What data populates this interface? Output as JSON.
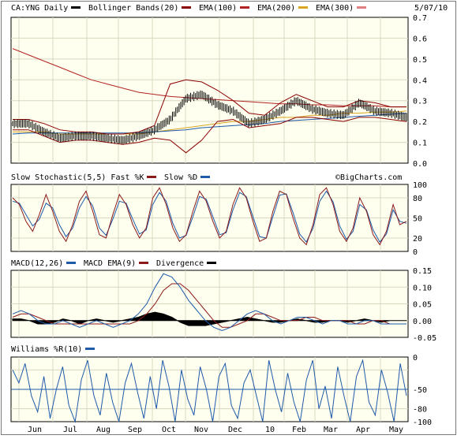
{
  "header": {
    "date": "5/07/10",
    "watermark": "©BigCharts.com"
  },
  "colors": {
    "panel_bg": "#fffff0",
    "grid": "#d8d8c0",
    "price": "#000000",
    "bollinger": "#8b0000",
    "ema100": "#b22222",
    "ema200": "#daa520",
    "ema300": "#1e5aa8",
    "ema300_swatch": "#e08080",
    "fast_k": "#8b1a1a",
    "slow_d": "#1e5aa8",
    "macd": "#1e5aa8",
    "macd_ema": "#8b1a1a",
    "divergence": "#000000",
    "williams": "#1e5aa8"
  },
  "panels": {
    "price": {
      "legend": [
        {
          "text": "CA:YNG Daily",
          "swatch": "#000000"
        },
        {
          "text": "Bollinger Bands(20)",
          "swatch": "#8b0000"
        },
        {
          "text": "EMA(100)",
          "swatch": "#b22222"
        },
        {
          "text": "EMA(200)",
          "swatch": "#daa520"
        },
        {
          "text": "EMA(300)",
          "swatch": "#e08080"
        }
      ],
      "ticks": [
        "0.7",
        "0.6",
        "0.5",
        "0.4",
        "0.3",
        "0.2",
        "0.1",
        "0.0"
      ]
    },
    "stoch": {
      "legend": [
        {
          "text": "Slow Stochastic(5,5) Fast %K",
          "swatch": "#8b1a1a"
        },
        {
          "text": "Slow %D",
          "swatch": "#1e5aa8"
        }
      ],
      "ticks": [
        "100",
        "80",
        "50",
        "20",
        "0"
      ]
    },
    "macd": {
      "legend": [
        {
          "text": "MACD(12,26)",
          "swatch": "#1e5aa8"
        },
        {
          "text": "MACD EMA(9)",
          "swatch": "#8b1a1a"
        },
        {
          "text": "Divergence",
          "swatch": "#000000"
        }
      ],
      "ticks": [
        "0.15",
        "0.10",
        "0.05",
        "0.00",
        "-0.05"
      ]
    },
    "williams": {
      "legend": [
        {
          "text": "Williams %R(10)",
          "swatch": "#1e5aa8"
        }
      ],
      "ticks": [
        "0",
        "-50",
        "-80",
        "-100"
      ]
    }
  },
  "x_axis": {
    "labels": [
      "Jun",
      "Jul",
      "Aug",
      "Sep",
      "Oct",
      "Nov",
      "Dec",
      "10",
      "Feb",
      "Mar",
      "Apr",
      "May"
    ]
  },
  "chart_data": [
    {
      "type": "line",
      "panel": "price",
      "title": "CA:YNG Daily",
      "x": [
        "2009-05-20",
        "2009-06-01",
        "2009-06-15",
        "2009-07-01",
        "2009-07-15",
        "2009-08-01",
        "2009-08-15",
        "2009-09-01",
        "2009-09-15",
        "2009-10-01",
        "2009-10-08",
        "2009-10-15",
        "2009-10-22",
        "2009-11-01",
        "2009-11-15",
        "2009-12-01",
        "2009-12-15",
        "2010-01-01",
        "2010-01-15",
        "2010-02-01",
        "2010-02-15",
        "2010-03-01",
        "2010-03-15",
        "2010-04-01",
        "2010-04-15",
        "2010-05-07"
      ],
      "series": [
        {
          "name": "CA:YNG Daily",
          "values": [
            0.19,
            0.19,
            0.15,
            0.12,
            0.13,
            0.13,
            0.12,
            0.11,
            0.13,
            0.16,
            0.21,
            0.31,
            0.33,
            0.28,
            0.25,
            0.19,
            0.21,
            0.25,
            0.3,
            0.26,
            0.24,
            0.23,
            0.29,
            0.25,
            0.24,
            0.22
          ]
        },
        {
          "name": "EMA(100)",
          "values": [
            0.55,
            0.52,
            0.49,
            0.46,
            0.43,
            0.4,
            0.38,
            0.36,
            0.34,
            0.33,
            0.32,
            0.315,
            0.31,
            0.305,
            0.3,
            0.295,
            0.29,
            0.285,
            0.285,
            0.28,
            0.28,
            0.275,
            0.275,
            0.275,
            0.27,
            0.27
          ]
        },
        {
          "name": "EMA(200)",
          "values": [
            0.15,
            0.15,
            0.15,
            0.14,
            0.14,
            0.14,
            0.14,
            0.14,
            0.14,
            0.15,
            0.16,
            0.17,
            0.18,
            0.19,
            0.2,
            0.2,
            0.21,
            0.22,
            0.22,
            0.23,
            0.23,
            0.24,
            0.24,
            0.245,
            0.245,
            0.25
          ]
        },
        {
          "name": "EMA(300)",
          "values": [
            0.14,
            0.145,
            0.145,
            0.145,
            0.145,
            0.145,
            0.145,
            0.145,
            0.145,
            0.15,
            0.155,
            0.16,
            0.17,
            0.175,
            0.18,
            0.185,
            0.19,
            0.2,
            0.205,
            0.21,
            0.215,
            0.22,
            0.225,
            0.23,
            0.235,
            0.24
          ]
        },
        {
          "name": "Bollinger Upper",
          "values": [
            0.21,
            0.21,
            0.19,
            0.16,
            0.15,
            0.15,
            0.14,
            0.14,
            0.15,
            0.18,
            0.38,
            0.4,
            0.39,
            0.35,
            0.3,
            0.24,
            0.23,
            0.29,
            0.33,
            0.3,
            0.27,
            0.27,
            0.3,
            0.29,
            0.27,
            0.27
          ]
        },
        {
          "name": "Bollinger Lower",
          "values": [
            0.16,
            0.16,
            0.13,
            0.1,
            0.11,
            0.11,
            0.1,
            0.09,
            0.1,
            0.12,
            0.11,
            0.05,
            0.11,
            0.2,
            0.21,
            0.17,
            0.18,
            0.19,
            0.22,
            0.22,
            0.21,
            0.2,
            0.22,
            0.22,
            0.21,
            0.2
          ]
        }
      ],
      "ylim": [
        0,
        0.7
      ],
      "grid": true
    },
    {
      "type": "line",
      "panel": "stoch",
      "title": "Slow Stochastic(5,5)",
      "x_count": 60,
      "series": [
        {
          "name": "Fast %K",
          "values": [
            80,
            70,
            45,
            30,
            55,
            85,
            60,
            30,
            15,
            40,
            75,
            90,
            60,
            25,
            20,
            55,
            85,
            70,
            40,
            20,
            35,
            80,
            95,
            70,
            35,
            15,
            25,
            60,
            90,
            75,
            45,
            20,
            30,
            70,
            95,
            80,
            45,
            15,
            20,
            60,
            90,
            85,
            50,
            20,
            10,
            40,
            85,
            95,
            70,
            30,
            15,
            35,
            80,
            60,
            25,
            10,
            30,
            70,
            40,
            45
          ]
        },
        {
          "name": "Slow %D",
          "values": [
            75,
            72,
            55,
            38,
            48,
            72,
            65,
            40,
            22,
            35,
            65,
            82,
            68,
            35,
            24,
            48,
            75,
            72,
            48,
            26,
            32,
            70,
            88,
            75,
            42,
            20,
            24,
            52,
            82,
            78,
            52,
            25,
            28,
            62,
            88,
            82,
            52,
            22,
            20,
            52,
            84,
            86,
            58,
            26,
            14,
            35,
            75,
            90,
            74,
            38,
            18,
            30,
            70,
            62,
            32,
            14,
            26,
            62,
            45,
            42
          ]
        }
      ],
      "ylim": [
        0,
        100
      ],
      "grid": true
    },
    {
      "type": "line",
      "panel": "macd",
      "title": "MACD(12,26)",
      "x_count": 48,
      "series": [
        {
          "name": "MACD",
          "values": [
            0.02,
            0.03,
            0.02,
            0.0,
            -0.01,
            -0.01,
            0.0,
            -0.01,
            -0.02,
            -0.01,
            0.0,
            -0.01,
            -0.02,
            -0.01,
            0.0,
            0.02,
            0.05,
            0.1,
            0.14,
            0.13,
            0.1,
            0.06,
            0.03,
            0.0,
            -0.02,
            -0.03,
            -0.02,
            0.0,
            0.02,
            0.03,
            0.02,
            0.0,
            -0.01,
            0.0,
            0.01,
            0.01,
            0.0,
            -0.01,
            0.0,
            0.0,
            -0.01,
            -0.01,
            0.0,
            0.0,
            -0.01,
            -0.01,
            -0.01,
            -0.01
          ]
        },
        {
          "name": "MACD EMA(9)",
          "values": [
            0.01,
            0.02,
            0.02,
            0.01,
            0.0,
            -0.01,
            -0.01,
            -0.01,
            -0.01,
            -0.01,
            -0.01,
            -0.01,
            -0.01,
            -0.01,
            -0.01,
            0.0,
            0.02,
            0.05,
            0.09,
            0.11,
            0.11,
            0.09,
            0.06,
            0.03,
            0.0,
            -0.02,
            -0.02,
            -0.01,
            0.0,
            0.02,
            0.02,
            0.01,
            0.0,
            0.0,
            0.0,
            0.01,
            0.01,
            0.0,
            0.0,
            0.0,
            0.0,
            -0.01,
            -0.01,
            0.0,
            0.0,
            -0.01,
            -0.01,
            -0.01
          ]
        },
        {
          "name": "Divergence",
          "values": [
            0.005,
            0.005,
            0.0,
            -0.01,
            -0.01,
            -0.005,
            0.005,
            0.0,
            -0.01,
            0.0,
            0.005,
            0.0,
            -0.005,
            0.0,
            0.005,
            0.01,
            0.02,
            0.025,
            0.02,
            0.01,
            -0.005,
            -0.015,
            -0.015,
            -0.015,
            -0.01,
            -0.005,
            0.0,
            0.005,
            0.01,
            0.005,
            0.0,
            -0.005,
            -0.005,
            0.0,
            0.005,
            0.0,
            -0.005,
            -0.005,
            0.0,
            0.0,
            -0.005,
            0.0,
            0.005,
            0.0,
            -0.005,
            0.0,
            0.0,
            0.0
          ]
        }
      ],
      "ylim": [
        -0.05,
        0.15
      ],
      "grid": true
    },
    {
      "type": "line",
      "panel": "williams",
      "title": "Williams %R(10)",
      "x_count": 64,
      "series": [
        {
          "name": "Williams %R",
          "values": [
            -20,
            -40,
            -10,
            -60,
            -85,
            -30,
            -95,
            -50,
            -15,
            -75,
            -100,
            -35,
            -5,
            -60,
            -90,
            -25,
            -70,
            -100,
            -40,
            -10,
            -55,
            -95,
            -30,
            -80,
            -5,
            -45,
            -100,
            -20,
            -65,
            -90,
            -15,
            -50,
            -100,
            -30,
            -10,
            -75,
            -95,
            -40,
            -20,
            -60,
            -100,
            -5,
            -50,
            -85,
            -25,
            -70,
            -100,
            -35,
            -5,
            -80,
            -45,
            -95,
            -15,
            -60,
            -100,
            -30,
            -5,
            -70,
            -90,
            -20,
            -55,
            -100,
            -10,
            -60
          ]
        }
      ],
      "ylim": [
        -100,
        0
      ],
      "grid": true
    }
  ]
}
